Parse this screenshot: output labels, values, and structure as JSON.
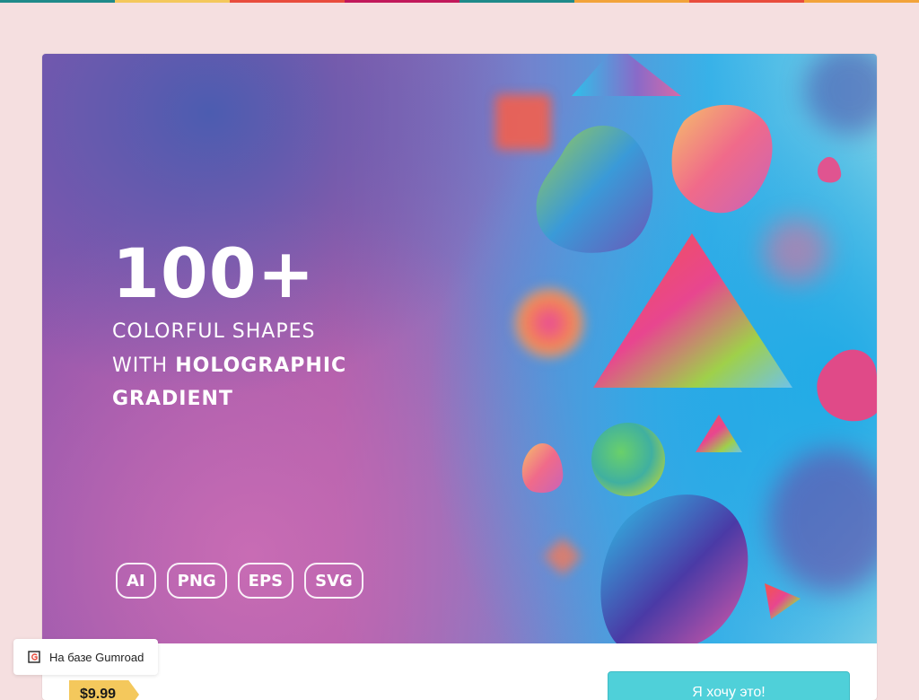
{
  "page": {
    "background_color": "#f5dfe0",
    "accent_strip_colors": [
      "#1f8a8a",
      "#f2a33a",
      "#e84c3d",
      "#c2185b",
      "#1f8a8a",
      "#f4c85c",
      "#e84c3d",
      "#f2a33a"
    ]
  },
  "cover": {
    "headline": "100+",
    "subline_1": "COLORFUL SHAPES",
    "subline_2_prefix": "WITH ",
    "subline_2_bold": "HOLOGRAPHIC",
    "subline_3": "GRADIENT",
    "formats": [
      "AI",
      "PNG",
      "EPS",
      "SVG"
    ]
  },
  "product": {
    "price": "$9.99",
    "buy_label": "Я хочу это!",
    "buy_color": "#4fd0d9",
    "price_color": "#f4c85c"
  },
  "footer_badge": {
    "label": "На базе Gumroad",
    "icon": "gumroad-icon"
  }
}
